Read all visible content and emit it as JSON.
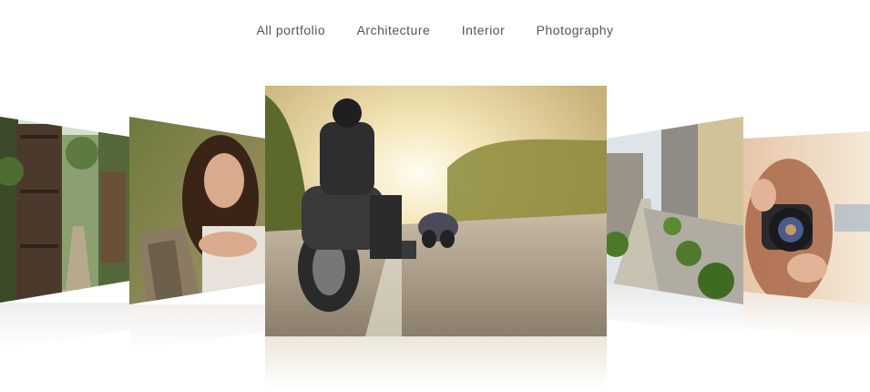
{
  "filters": [
    "All portfolio",
    "Architecture",
    "Interior",
    "Photography"
  ],
  "slides": [
    {
      "name": "garden-gate",
      "subject": "wooden garden gate and path"
    },
    {
      "name": "woman-portrait",
      "subject": "woman portrait leaning on wood"
    },
    {
      "name": "motorcycle-road",
      "subject": "motorcyclist riding into sunset"
    },
    {
      "name": "house-walkway",
      "subject": "modern house side walkway"
    },
    {
      "name": "photographer",
      "subject": "woman holding camera"
    }
  ],
  "colors": {
    "nav_text": "#555555",
    "background": "#ffffff"
  }
}
